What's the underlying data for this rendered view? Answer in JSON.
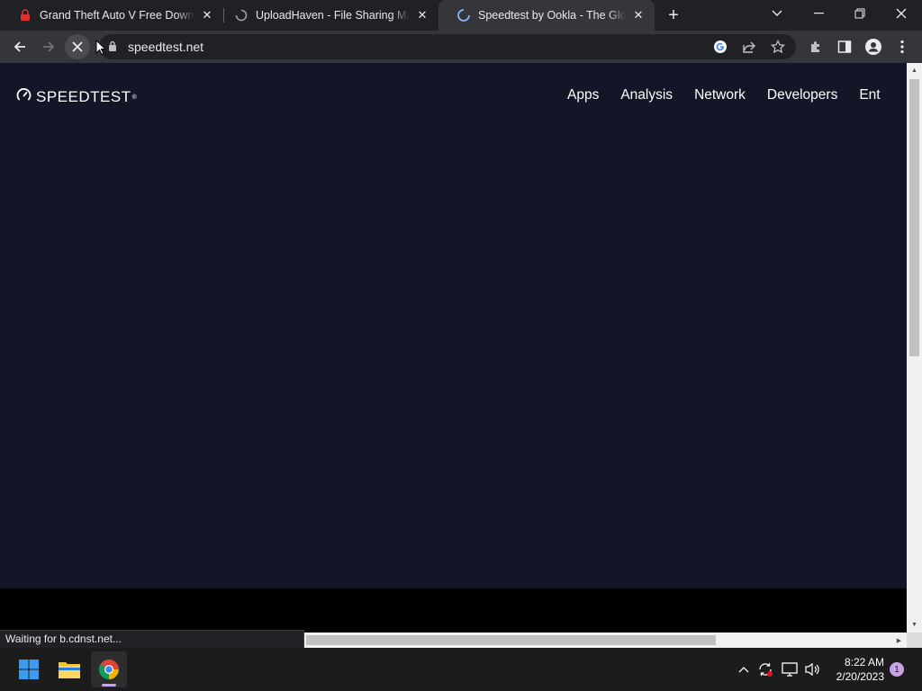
{
  "browser": {
    "tabs": [
      {
        "title": "Grand Theft Auto V Free Download",
        "favicon": "game-favicon",
        "active": false
      },
      {
        "title": "UploadHaven - File Sharing Made",
        "favicon": "loading-spinner",
        "active": false
      },
      {
        "title": "Speedtest by Ookla - The Global",
        "favicon": "loading-spinner",
        "active": true
      }
    ],
    "close_label": "✕",
    "new_tab_label": "+",
    "address": {
      "url": "speedtest.net"
    },
    "status_text": "Waiting for b.cdnst.net..."
  },
  "page": {
    "logo_text": "SPEEDTEST",
    "logo_mark": "®",
    "nav": [
      "Apps",
      "Analysis",
      "Network",
      "Developers",
      "Ent"
    ],
    "background_color": "#141526"
  },
  "taskbar": {
    "apps": [
      "windows-start",
      "file-explorer",
      "chrome"
    ],
    "clock_time": "8:22 AM",
    "clock_date": "2/20/2023",
    "notification_count": "1"
  }
}
